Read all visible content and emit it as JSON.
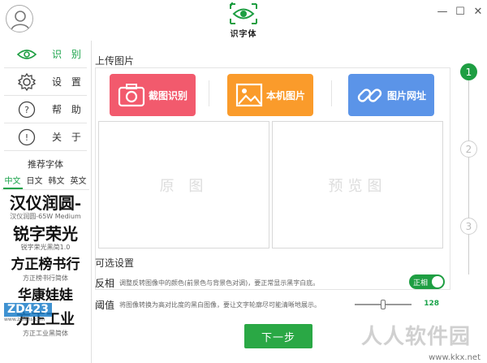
{
  "app": {
    "title": "识字体"
  },
  "colors": {
    "accent": "#1e9e42",
    "red": "#f25a6d",
    "orange": "#fa9b2b",
    "blue": "#5b94e8"
  },
  "sidebar": {
    "items": [
      {
        "label": "识 别",
        "icon": "eye-icon",
        "active": true
      },
      {
        "label": "设 置",
        "icon": "gear-icon",
        "active": false
      },
      {
        "label": "帮 助",
        "icon": "help-icon",
        "active": false
      },
      {
        "label": "关 于",
        "icon": "info-icon",
        "active": false
      }
    ],
    "recommend_title": "推荐字体",
    "lang_tabs": [
      "中文",
      "日文",
      "韩文",
      "英文"
    ],
    "fonts": [
      {
        "name": "汉仪润圆-",
        "caption": "汉仪润圆-65W Medium"
      },
      {
        "name": "锐字荣光",
        "caption": "锐字荣光黑简1.0"
      },
      {
        "name": "方正榜书行",
        "caption": "方正榜书行简体"
      },
      {
        "name": "华康娃娃",
        "caption": ""
      },
      {
        "name": "方正工业",
        "caption": "方正工业黑简体"
      }
    ],
    "logo_text": "ZD423",
    "logo_url": "www.zdfans.com"
  },
  "main": {
    "upload_title": "上传图片",
    "buttons": {
      "capture": "截图识别",
      "local": "本机图片",
      "url": "图片网址"
    },
    "preview_original": "原 图",
    "preview_result": "预览图",
    "options_title": "可选设置",
    "invert": {
      "label": "反相",
      "desc": "调整反转图像中的颜色(前景色与背景色对调)，要正常显示黑字白底。",
      "toggle": "正相"
    },
    "threshold": {
      "label": "阈值",
      "desc": "将图像转换为高对比度的黑白图像，要让文字轮廓尽可能清晰地展示。",
      "value": "128",
      "level": 0.5
    },
    "next_label": "下一步"
  },
  "steps": [
    "1",
    "2",
    "3"
  ],
  "watermark": {
    "name": "人人软件园",
    "url": "www.kkx.net"
  }
}
